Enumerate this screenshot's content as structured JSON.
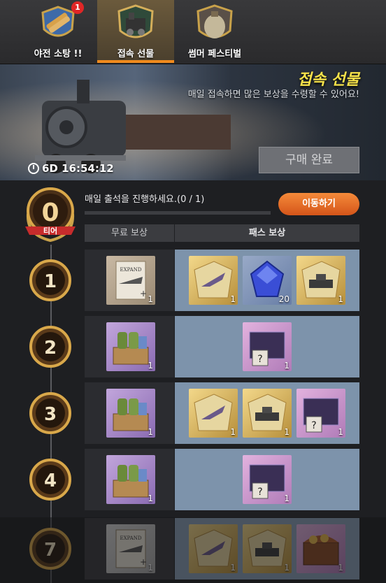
{
  "tabs": [
    {
      "label": "야전 소탕 !!",
      "icon": "military-badge-icon",
      "badge": "1",
      "active": false
    },
    {
      "label": "접속 선물",
      "icon": "train-emblem-icon",
      "active": true
    },
    {
      "label": "썸머 페스티벌",
      "icon": "canteen-icon",
      "active": false
    }
  ],
  "banner": {
    "title": "접속 선물",
    "subtitle": "매일 접속하면 많은 보상을 수령할 수 있어요!",
    "timer": "6D 16:54:12",
    "buy_button": "구매 완료"
  },
  "tier": {
    "value": "0",
    "label": "티어"
  },
  "progress": {
    "text": "매일 출석을 진행하세요.(0 / 1)",
    "fraction": 0.0
  },
  "move_button": "이동하기",
  "columns": {
    "free": "무료 보상",
    "pass": "패스 보상"
  },
  "rows": [
    {
      "level": "1",
      "free": [
        {
          "icon": "expand-mod-slot-icon",
          "count": "1",
          "bg": "paper"
        }
      ],
      "pass": [
        {
          "icon": "aircraft-blueprint-icon",
          "count": "1",
          "bg": "gold"
        },
        {
          "icon": "sapphire-gem-icon",
          "count": "20",
          "bg": "blue"
        },
        {
          "icon": "tank-blueprint-icon",
          "count": "1",
          "bg": "gold"
        }
      ]
    },
    {
      "level": "2",
      "free": [
        {
          "icon": "supply-crate-icon",
          "count": "1",
          "bg": "purple"
        }
      ],
      "pass": [
        {
          "icon": "mystery-chest-icon",
          "count": "1",
          "bg": "pink"
        }
      ]
    },
    {
      "level": "3",
      "free": [
        {
          "icon": "supply-crate-icon",
          "count": "1",
          "bg": "purple"
        }
      ],
      "pass": [
        {
          "icon": "aircraft-blueprint-icon",
          "count": "1",
          "bg": "gold"
        },
        {
          "icon": "tank-blueprint-icon",
          "count": "1",
          "bg": "gold"
        },
        {
          "icon": "mystery-chest-icon",
          "count": "1",
          "bg": "pink"
        }
      ]
    },
    {
      "level": "4",
      "free": [
        {
          "icon": "supply-crate-icon",
          "count": "1",
          "bg": "purple"
        }
      ],
      "pass": [
        {
          "icon": "mystery-chest-icon",
          "count": "1",
          "bg": "pink"
        }
      ]
    },
    {
      "level": "7",
      "free": [
        {
          "icon": "expand-mod-slot-icon",
          "count": "1",
          "bg": "grey"
        }
      ],
      "pass": [
        {
          "icon": "aircraft-blueprint-icon",
          "count": "1",
          "bg": "gold"
        },
        {
          "icon": "tank-blueprint-icon",
          "count": "1",
          "bg": "gold"
        },
        {
          "icon": "treasure-chest-icon",
          "count": "1",
          "bg": "pink"
        }
      ]
    }
  ],
  "colors": {
    "accent": "#f08a1c",
    "title_yellow": "#f6e24a",
    "pass_bg": "#7d93ab"
  }
}
